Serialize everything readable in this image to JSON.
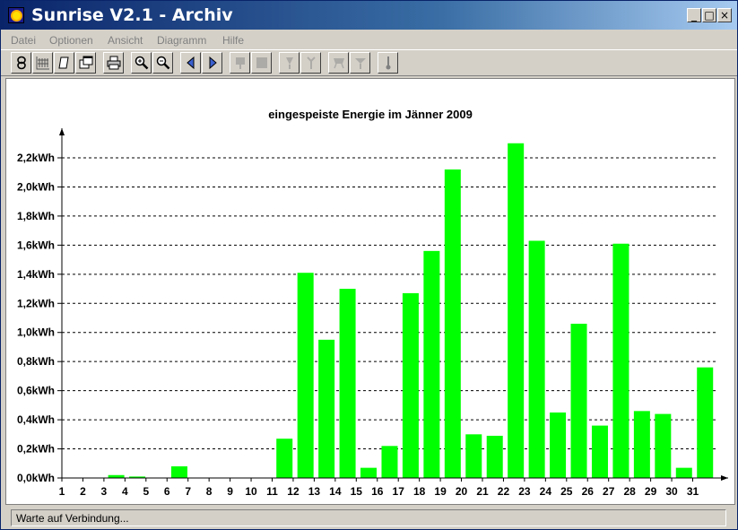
{
  "window": {
    "title": "Sunrise V2.1 - Archiv"
  },
  "title_buttons": {
    "minimize": "_",
    "maximize": "□",
    "close": "×"
  },
  "menu": [
    "Datei",
    "Optionen",
    "Ansicht",
    "Diagramm",
    "Hilfe"
  ],
  "toolbar": [
    {
      "icon": "connect-icon",
      "enabled": true
    },
    {
      "icon": "grid-icon",
      "enabled": true
    },
    {
      "icon": "document-icon",
      "enabled": true
    },
    {
      "icon": "windows-icon",
      "enabled": true
    },
    {
      "icon": "printer-icon",
      "enabled": true
    },
    {
      "icon": "zoom-in-icon",
      "enabled": true
    },
    {
      "icon": "zoom-out-icon",
      "enabled": true
    },
    {
      "icon": "previous-icon",
      "enabled": true
    },
    {
      "icon": "next-icon",
      "enabled": true
    },
    {
      "icon": "marker-icon",
      "enabled": false
    },
    {
      "icon": "square-icon",
      "enabled": false
    },
    {
      "icon": "tool-a-icon",
      "enabled": false
    },
    {
      "icon": "tool-b-icon",
      "enabled": false
    },
    {
      "icon": "tool-c-icon",
      "enabled": false
    },
    {
      "icon": "tool-d-icon",
      "enabled": false
    },
    {
      "icon": "thermometer-icon",
      "enabled": true
    }
  ],
  "colors": {
    "bar": "#00ff00",
    "grid": "#000000"
  },
  "chart_data": {
    "type": "bar",
    "title": "eingespeiste Energie im Jänner 2009",
    "categories": [
      "1",
      "2",
      "3",
      "4",
      "5",
      "6",
      "7",
      "8",
      "9",
      "10",
      "11",
      "12",
      "13",
      "14",
      "15",
      "16",
      "17",
      "18",
      "19",
      "20",
      "21",
      "22",
      "23",
      "24",
      "25",
      "26",
      "27",
      "28",
      "29",
      "30",
      "31"
    ],
    "values": [
      0,
      0,
      0.02,
      0.01,
      0,
      0.08,
      0,
      0,
      0,
      0,
      0.27,
      1.41,
      0.95,
      1.3,
      0.07,
      0.22,
      1.27,
      1.56,
      2.12,
      0.3,
      0.29,
      2.3,
      1.63,
      0.45,
      1.06,
      0.36,
      1.61,
      0.46,
      0.44,
      0.07,
      0.76
    ],
    "yticks": [
      "0,0kWh",
      "0,2kWh",
      "0,4kWh",
      "0,6kWh",
      "0,8kWh",
      "1,0kWh",
      "1,2kWh",
      "1,4kWh",
      "1,6kWh",
      "1,8kWh",
      "2,0kWh",
      "2,2kWh"
    ],
    "ylim": [
      0,
      2.2
    ],
    "grid": true
  },
  "status": {
    "text": "Warte auf Verbindung..."
  }
}
